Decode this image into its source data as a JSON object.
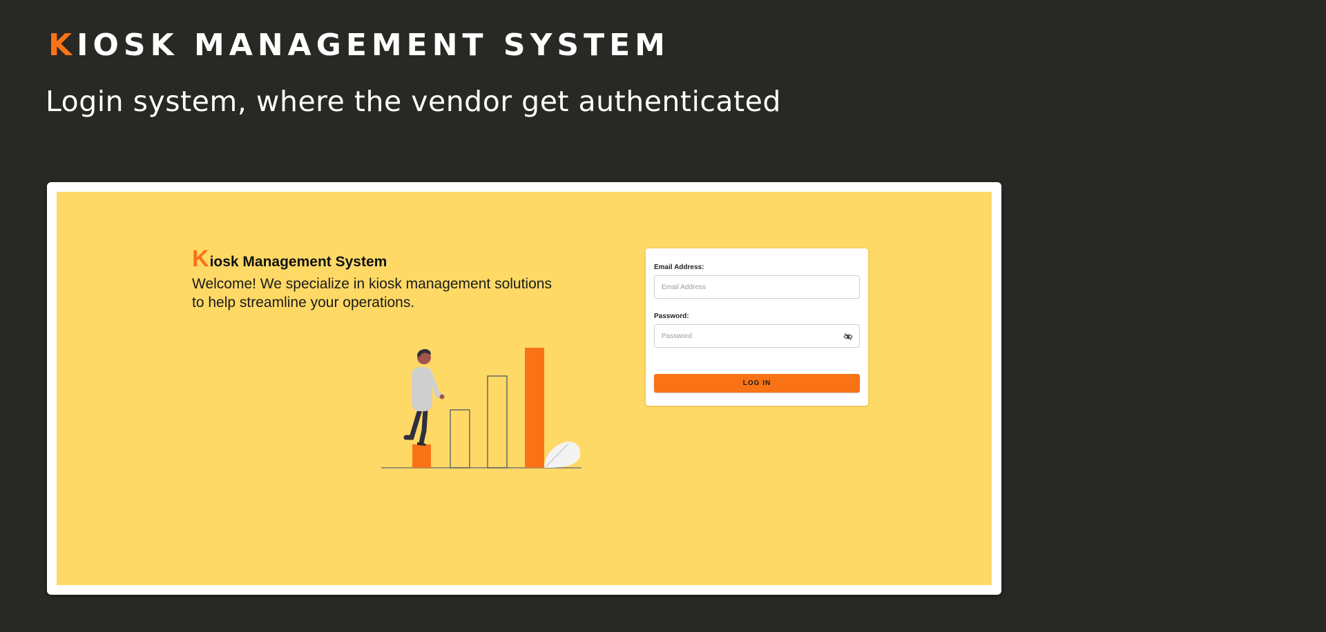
{
  "hero": {
    "title_initial": "K",
    "title_rest": "IOSK MANAGEMENT SYSTEM",
    "subtitle": "Login system, where the vendor get authenticated"
  },
  "app": {
    "brand_initial": "K",
    "brand_rest": "iosk Management System",
    "welcome_text": "Welcome! We specialize in kiosk management solutions to help streamline your operations."
  },
  "login": {
    "email_label": "Email Address:",
    "email_placeholder": "Email Address",
    "email_value": "",
    "password_label": "Password:",
    "password_placeholder": "Password",
    "password_value": "",
    "toggle_icon": "eye-off-icon",
    "submit_label": "LOG IN"
  },
  "colors": {
    "background": "#282824",
    "accent": "#f97316",
    "panel": "#ffd966",
    "text_light": "#ffffff"
  }
}
